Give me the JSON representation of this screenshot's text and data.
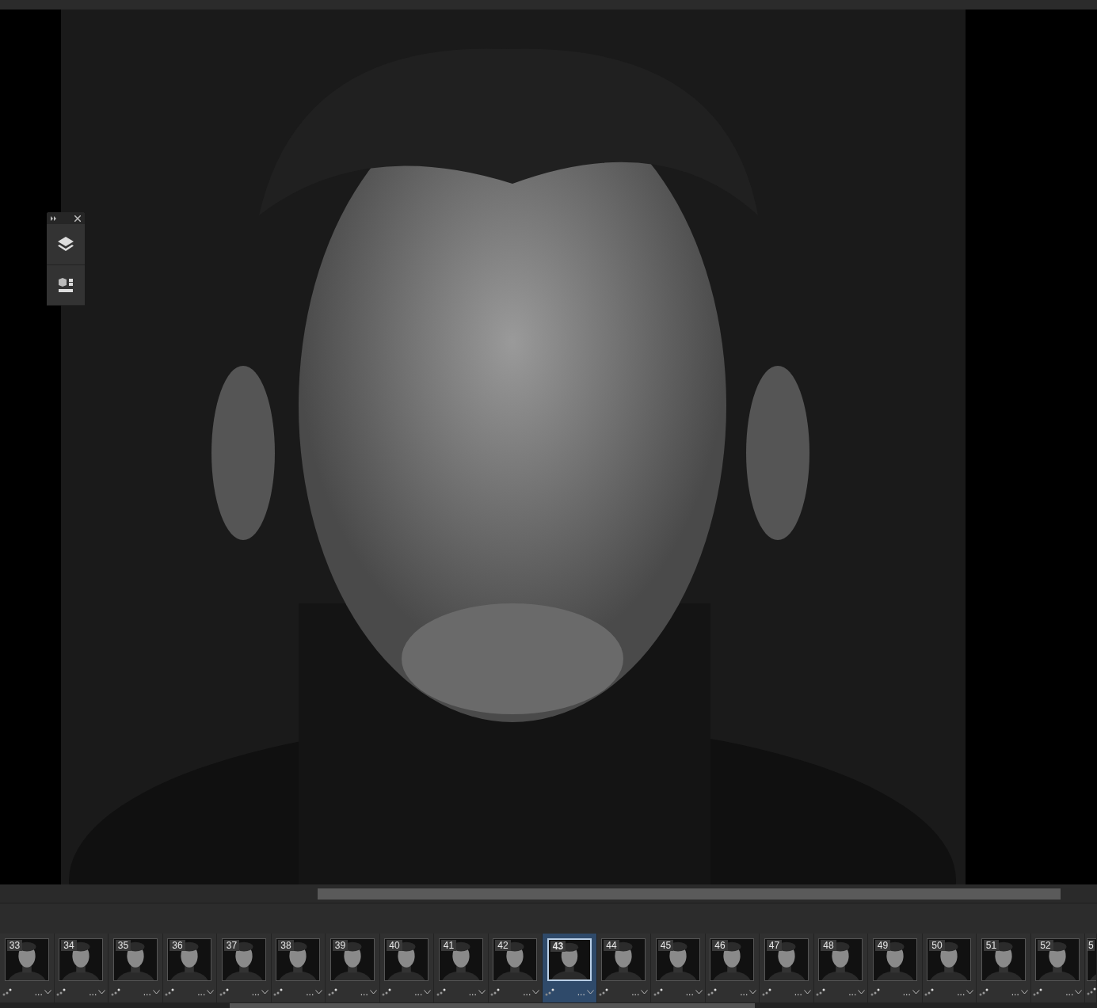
{
  "frames": [
    {
      "number": "33",
      "delay": "...",
      "selected": false
    },
    {
      "number": "34",
      "delay": "...",
      "selected": false
    },
    {
      "number": "35",
      "delay": "...",
      "selected": false
    },
    {
      "number": "36",
      "delay": "...",
      "selected": false
    },
    {
      "number": "37",
      "delay": "...",
      "selected": false
    },
    {
      "number": "38",
      "delay": "...",
      "selected": false
    },
    {
      "number": "39",
      "delay": "...",
      "selected": false
    },
    {
      "number": "40",
      "delay": "...",
      "selected": false
    },
    {
      "number": "41",
      "delay": "...",
      "selected": false
    },
    {
      "number": "42",
      "delay": "...",
      "selected": false
    },
    {
      "number": "43",
      "delay": "...",
      "selected": true
    },
    {
      "number": "44",
      "delay": "...",
      "selected": false
    },
    {
      "number": "45",
      "delay": "...",
      "selected": false
    },
    {
      "number": "46",
      "delay": "...",
      "selected": false
    },
    {
      "number": "47",
      "delay": "...",
      "selected": false
    },
    {
      "number": "48",
      "delay": "...",
      "selected": false
    },
    {
      "number": "49",
      "delay": "...",
      "selected": false
    },
    {
      "number": "50",
      "delay": "...",
      "selected": false
    },
    {
      "number": "51",
      "delay": "...",
      "selected": false
    },
    {
      "number": "52",
      "delay": "...",
      "selected": false
    },
    {
      "number": "5",
      "selected": false
    }
  ]
}
